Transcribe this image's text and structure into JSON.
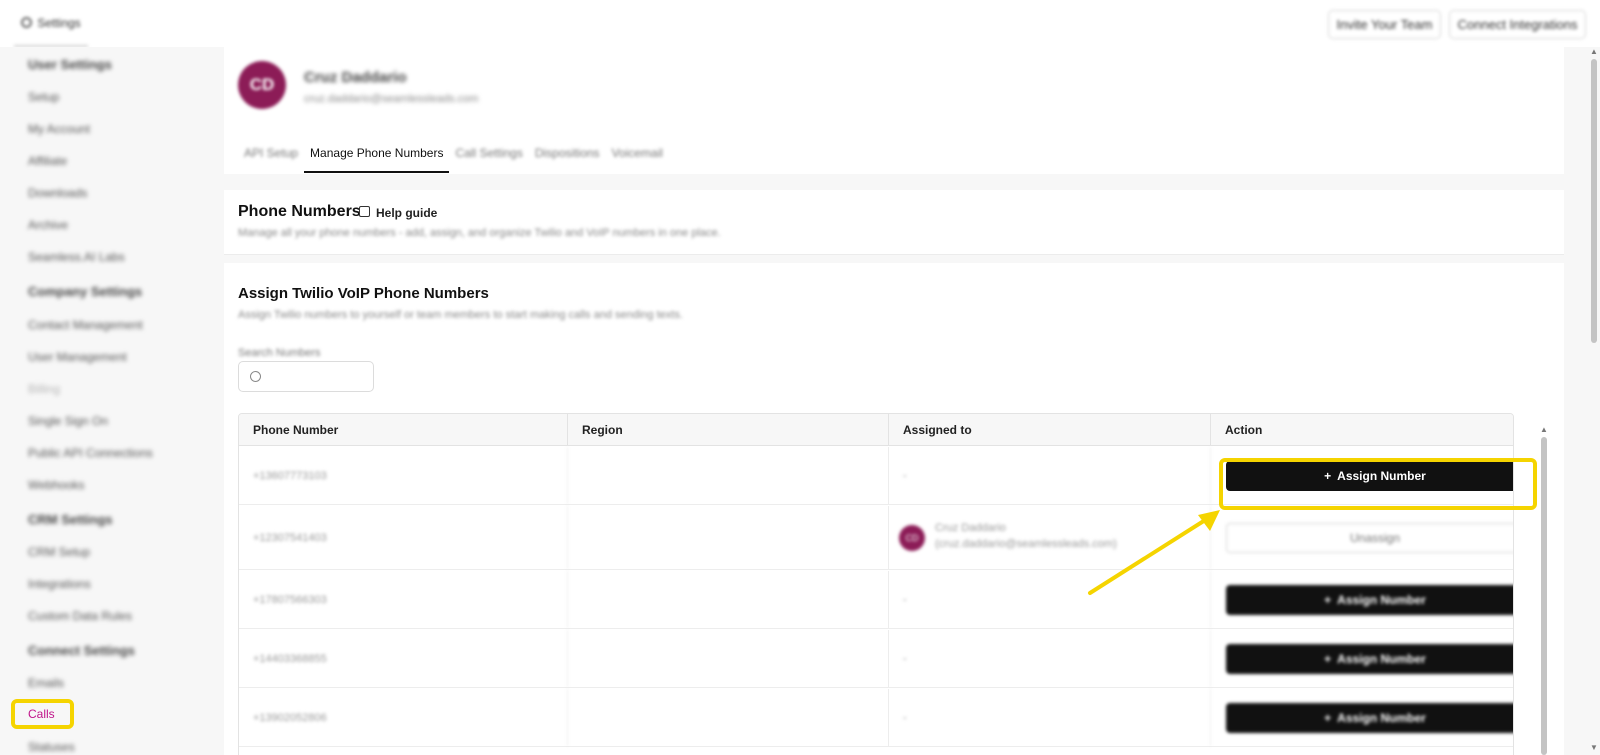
{
  "topbar": {
    "settings_tab": "Settings",
    "invite_team": "Invite Your Team",
    "connect_integrations": "Connect Integrations"
  },
  "sidebar": {
    "user_settings": "User Settings",
    "setup": "Setup",
    "my_account": "My Account",
    "affiliate": "Affiliate",
    "downloads": "Downloads",
    "archive": "Archive",
    "ai_labs": "Seamless.AI Labs",
    "company_settings": "Company Settings",
    "contact_management": "Contact Management",
    "user_management": "User Management",
    "billing": "Billing",
    "sso": "Single Sign On",
    "public_api": "Public API Connections",
    "webhooks": "Webhooks",
    "crm_settings": "CRM Settings",
    "crm_setup": "CRM Setup",
    "integrations": "Integrations",
    "custom_data_rules": "Custom Data Rules",
    "connect_settings": "Connect Settings",
    "emails": "Emails",
    "calls": "Calls",
    "statuses": "Statuses"
  },
  "profile": {
    "initials": "CD",
    "name": "Cruz Daddario",
    "email": "cruz.daddario@seamlessleads.com"
  },
  "tabs": {
    "api_setup": "API Setup",
    "manage_phone_numbers": "Manage Phone Numbers",
    "call_settings": "Call Settings",
    "dispositions": "Dispositions",
    "voicemail": "Voicemail"
  },
  "phone_numbers": {
    "title": "Phone Numbers",
    "help_guide": "Help guide",
    "subtitle": "Manage all your phone numbers - add, assign, and organize Twilio and VoIP numbers in one place."
  },
  "assign": {
    "title": "Assign Twilio VoIP Phone Numbers",
    "subtitle": "Assign Twilio numbers to yourself or team members to start making calls and sending texts.",
    "search_label": "Search Numbers",
    "search_placeholder": ""
  },
  "table": {
    "headers": {
      "phone": "Phone Number",
      "region": "Region",
      "assigned": "Assigned to",
      "action": "Action"
    },
    "rows": [
      {
        "phone": "+13607773103",
        "region": "",
        "assigned": "-",
        "action": "Assign Number"
      },
      {
        "phone": "+12307541403",
        "region": "",
        "assigned_initials": "CD",
        "assigned_name": "Cruz Daddario",
        "assigned_email": "(cruz.daddario@seamlessleads.com)",
        "action": "Unassign"
      },
      {
        "phone": "+17807566303",
        "region": "",
        "assigned": "-",
        "action": "Assign Number"
      },
      {
        "phone": "+14403368855",
        "region": "",
        "assigned": "-",
        "action": "Assign Number"
      },
      {
        "phone": "+13902052806",
        "region": "",
        "assigned": "-",
        "action": "Assign Number"
      }
    ]
  },
  "colors": {
    "highlight": "#f5d400",
    "avatar": "#8c1c57",
    "calls_active": "#c0148a"
  }
}
